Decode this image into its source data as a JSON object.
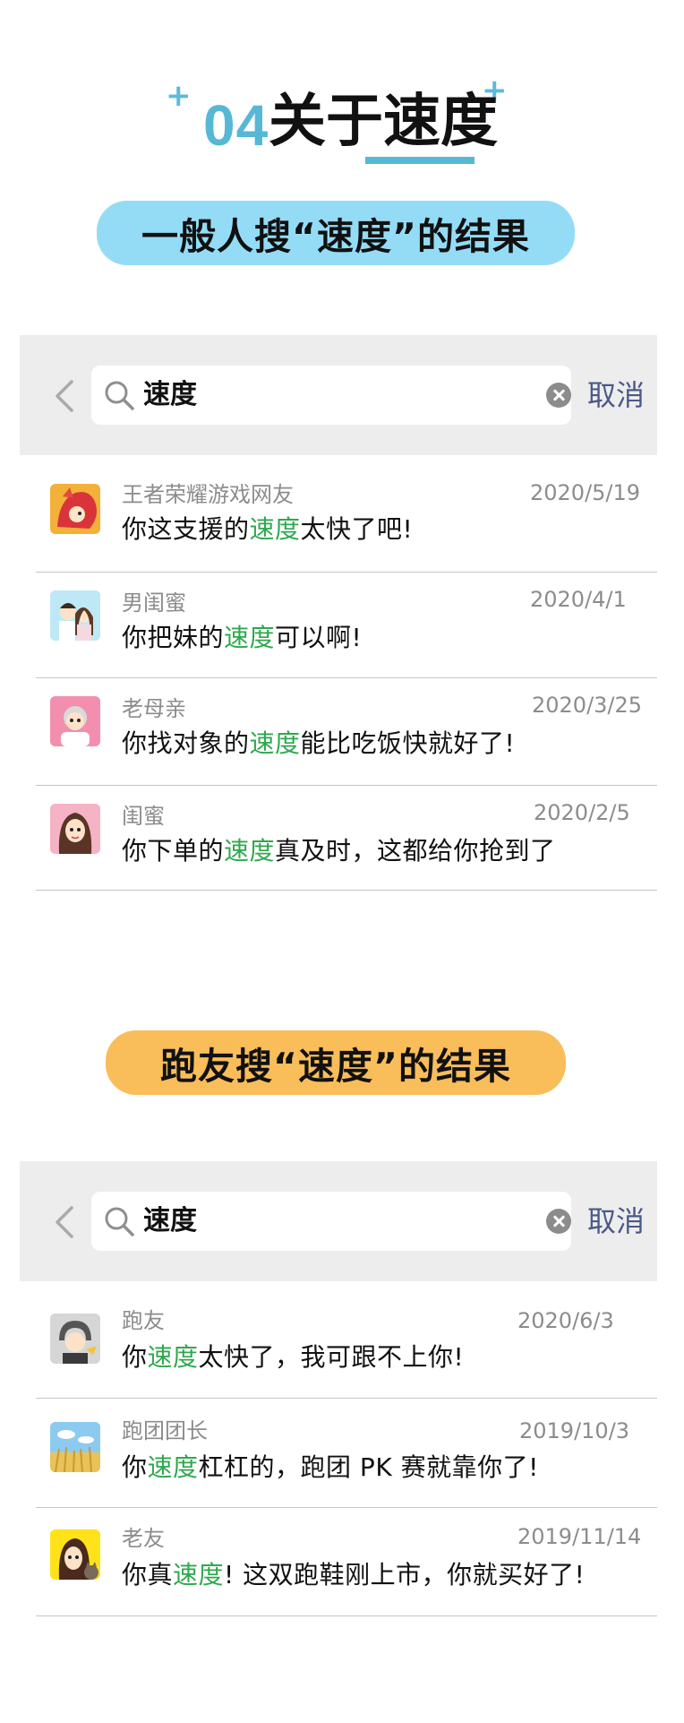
{
  "title": {
    "number": "04",
    "text": "关于速度"
  },
  "section1": {
    "pill": "一般人搜“速度”的结果",
    "search": {
      "query": "速度",
      "cancel": "取消"
    },
    "results": [
      {
        "sender": "王者荣耀游戏网友",
        "date": "2020/5/19",
        "before": "你这支援的",
        "keyword": "速度",
        "after": "太快了吧!"
      },
      {
        "sender": "男闺蜜",
        "date": "2020/4/1",
        "before": "你把妹的",
        "keyword": "速度",
        "after": "可以啊!"
      },
      {
        "sender": "老母亲",
        "date": "2020/3/25",
        "before": "你找对象的",
        "keyword": "速度",
        "after": "能比吃饭快就好了!"
      },
      {
        "sender": "闺蜜",
        "date": "2020/2/5",
        "before": "你下单的",
        "keyword": "速度",
        "after": "真及时，这都给你抢到了"
      }
    ]
  },
  "section2": {
    "pill": "跑友搜“速度”的结果",
    "search": {
      "query": "速度",
      "cancel": "取消"
    },
    "results": [
      {
        "sender": "跑友",
        "date": "2020/6/3",
        "before": "你",
        "keyword": "速度",
        "after": "太快了，我可跟不上你!"
      },
      {
        "sender": "跑团团长",
        "date": "2019/10/3",
        "before": "你",
        "keyword": "速度",
        "after": "杠杠的，跑团 PK 赛就靠你了!"
      },
      {
        "sender": "老友",
        "date": "2019/11/14",
        "before": "你真",
        "keyword": "速度",
        "after": "! 这双跑鞋刚上市，你就买好了!"
      }
    ]
  },
  "colors": {
    "accent_blue": "#57b8d6",
    "pill_blue": "#94dcf6",
    "pill_orange": "#f9bd5a",
    "highlight_green": "#2fa84f",
    "cancel_text": "#4a5a88"
  }
}
